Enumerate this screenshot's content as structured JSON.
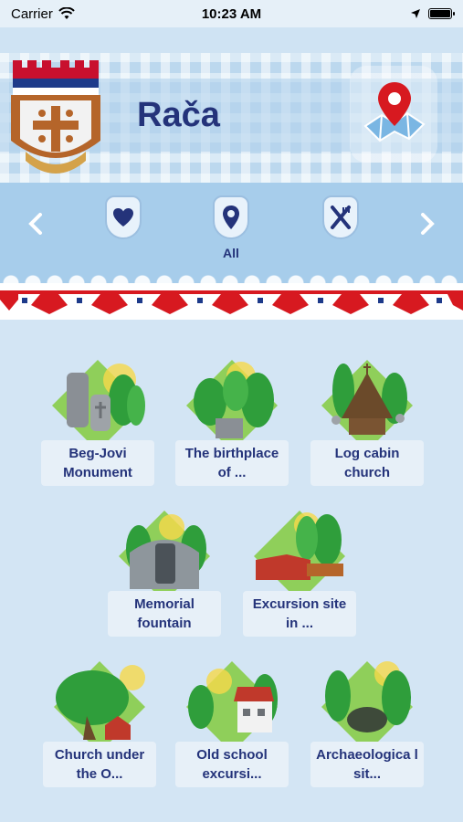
{
  "status_bar": {
    "carrier": "Carrier",
    "time": "10:23 AM"
  },
  "header": {
    "title": "Rača"
  },
  "categories": {
    "selected_label": "All",
    "items": [
      {
        "name": "favorites",
        "icon": "heart-icon"
      },
      {
        "name": "all",
        "icon": "map-pin-icon"
      },
      {
        "name": "food",
        "icon": "fork-knife-icon"
      }
    ]
  },
  "places": [
    {
      "label": "Beg-Jovi Monument"
    },
    {
      "label": "The birthplace of ..."
    },
    {
      "label": "Log cabin church"
    },
    {
      "label": "Memorial fountain"
    },
    {
      "label": "Excursion site in ..."
    },
    {
      "label": "Church under the O..."
    },
    {
      "label": "Old school excursi..."
    },
    {
      "label": "Archaeologica l sit..."
    }
  ],
  "colors": {
    "title": "#24337a",
    "accent_red": "#d71920",
    "background": "#d3e5f4"
  }
}
